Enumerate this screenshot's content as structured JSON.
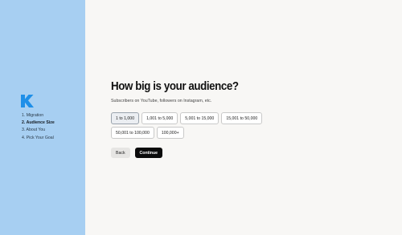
{
  "sidebar": {
    "logo_icon": "k-logo-icon",
    "accent_color": "#1e8fe8",
    "steps": [
      {
        "label": "1. Migration"
      },
      {
        "label": "2. Audience Size"
      },
      {
        "label": "3. About You"
      },
      {
        "label": "4. Pick Your Goal"
      }
    ],
    "active_step": 1
  },
  "main": {
    "title": "How big is your audience?",
    "subtitle": "Subscribers on YouTube, followers on Instagram, etc.",
    "options": [
      {
        "label": "1 to 1,000",
        "selected": true
      },
      {
        "label": "1,001 to 5,000",
        "selected": false
      },
      {
        "label": "5,001 to 15,000",
        "selected": false
      },
      {
        "label": "15,001 to 50,000",
        "selected": false
      },
      {
        "label": "50,001 to 100,000",
        "selected": false
      },
      {
        "label": "100,000+",
        "selected": false
      }
    ],
    "back_label": "Back",
    "continue_label": "Continue"
  }
}
